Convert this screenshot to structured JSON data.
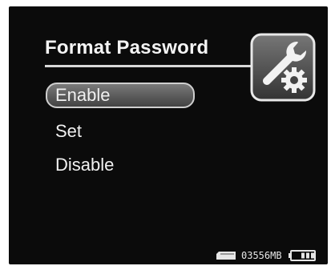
{
  "header": {
    "title": "Format Password",
    "icon": "settings-wrench-gear-icon"
  },
  "menu": {
    "items": [
      {
        "label": "Enable",
        "selected": true
      },
      {
        "label": "Set",
        "selected": false
      },
      {
        "label": "Disable",
        "selected": false
      }
    ]
  },
  "status": {
    "storage_icon": "memory-card-icon",
    "free_space": "03556MB",
    "battery_icon": "battery-icon",
    "battery_level": 0.75
  },
  "colors": {
    "background": "#0b0b0b",
    "text": "#f0f0f0",
    "selection": "#5a5a5a"
  }
}
